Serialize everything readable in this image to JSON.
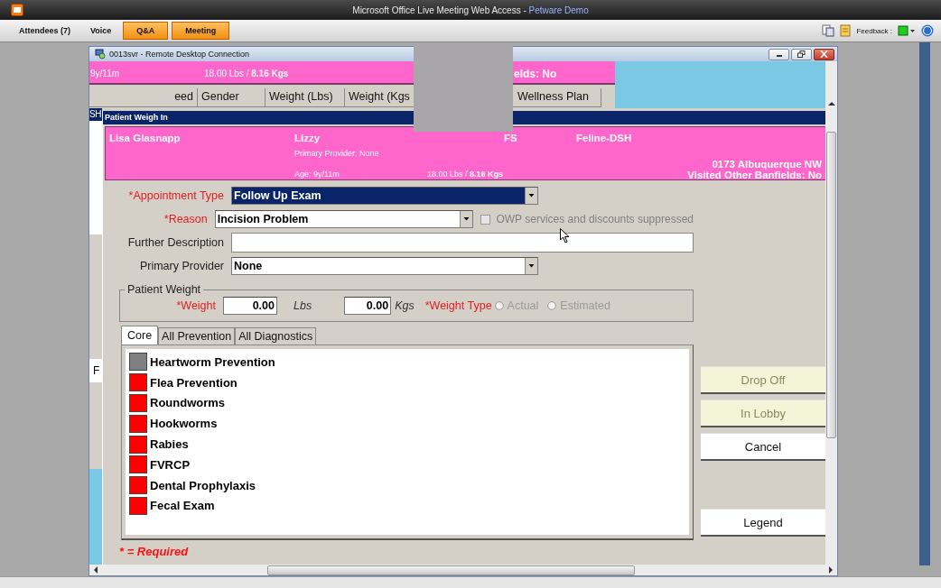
{
  "app_window": {
    "title": "Microsoft Office Live Meeting Web Access - ",
    "title_suffix": "Petware Demo"
  },
  "toolbar": {
    "items": [
      {
        "label": "Attendees (7)",
        "highlighted": false
      },
      {
        "label": "Voice",
        "highlighted": false
      },
      {
        "label": "Q&A",
        "highlighted": true
      },
      {
        "label": "Meeting",
        "highlighted": true
      }
    ],
    "feedback_label": "Feedback :"
  },
  "remote_window": {
    "title": "0013svr - Remote Desktop Connection"
  },
  "background_app": {
    "age": "9y/11m",
    "weight": "18.00 Lbs / **8.16 Kgs**",
    "visited": "elds: No",
    "columns": [
      "eed",
      "Gender",
      "Weight (Lbs)",
      "Weight (Kgs",
      "Wellness Plan"
    ],
    "row_fragment": "SH",
    "side_fragment": "F"
  },
  "dialog": {
    "title": "Patient Weigh In",
    "patient": {
      "owner": "Lisa Glasnapp",
      "pet": "Lizzy",
      "sex": "FS",
      "breed": "Feline-DSH",
      "provider": "Primary Provider: None",
      "address": "0173 Albuquerque NW",
      "age": "Age: 9y/11m",
      "weight": "18.00 Lbs / **8.16 Kgs**",
      "visited": "Visited Other Banfields: No"
    },
    "fields": [
      {
        "label": "*Appointment Type",
        "kind": "select",
        "required": true,
        "focused": true,
        "value": "Follow Up Exam"
      },
      {
        "label": "*Reason",
        "kind": "select",
        "required": true,
        "focused": false,
        "value": "Incision Problem"
      },
      {
        "label": "Further Description",
        "kind": "text",
        "required": false
      },
      {
        "label": "Primary Provider",
        "kind": "select",
        "required": false,
        "focused": false,
        "value": "None"
      }
    ],
    "owp_checkbox": {
      "label": "OWP services and discounts suppressed",
      "checked": false,
      "disabled": true
    },
    "weight_group": {
      "legend": "Patient Weight",
      "weight_label": "*Weight",
      "lbs_value": "0.00",
      "lbs_unit": "Lbs",
      "kgs_value": "0.00",
      "kgs_unit": "Kgs",
      "type_label": "*Weight Type",
      "options": [
        {
          "label": "Actual",
          "selected": false
        },
        {
          "label": "Estimated",
          "selected": false
        }
      ]
    },
    "tabs": [
      {
        "label": "Core",
        "selected": true
      },
      {
        "label": "All Prevention",
        "selected": false
      },
      {
        "label": "All Diagnostics",
        "selected": false
      }
    ],
    "items": [
      {
        "label": "Heartworm Prevention",
        "color": "#808080"
      },
      {
        "label": "Flea Prevention",
        "color": "#ff0000"
      },
      {
        "label": "Roundworms",
        "color": "#ff0000"
      },
      {
        "label": "Hookworms",
        "color": "#ff0000"
      },
      {
        "label": "Rabies",
        "color": "#ff0000"
      },
      {
        "label": "FVRCP",
        "color": "#ff0000"
      },
      {
        "label": "Dental Prophylaxis",
        "color": "#ff0000"
      },
      {
        "label": "Fecal Exam",
        "color": "#ff0000"
      }
    ],
    "buttons": [
      {
        "label": "Drop Off",
        "kind": "status"
      },
      {
        "label": "In Lobby",
        "kind": "status"
      },
      {
        "label": "Cancel",
        "kind": "action"
      },
      {
        "label": "Legend",
        "kind": "separate"
      }
    ],
    "required_note": "* = Required"
  }
}
